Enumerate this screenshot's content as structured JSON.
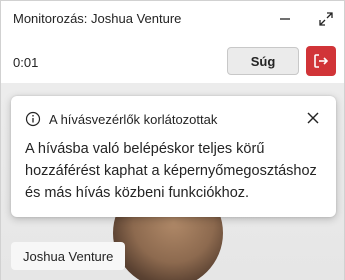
{
  "window": {
    "title": "Monitorozás: Joshua Venture"
  },
  "call": {
    "timer": "0:01",
    "help_button": "Súg",
    "leave_icon": "leave-call-icon",
    "leave_color": "#d13438"
  },
  "banner": {
    "info_icon": "info-icon",
    "title": "A hívásvezérlők korlátozottak",
    "message": "A hívásba való belépéskor teljes körű hozzáférést kaphat a képernyőmegosztáshoz és más hívás közbeni funkciókhoz.",
    "close_icon": "close-icon"
  },
  "participant": {
    "name": "Joshua Venture"
  }
}
